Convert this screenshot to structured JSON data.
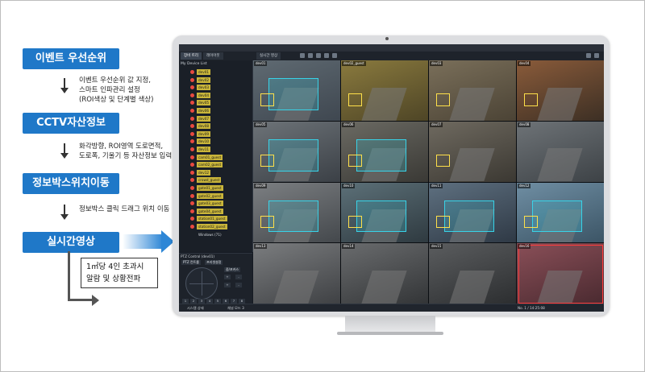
{
  "flow": {
    "steps": [
      {
        "label": "이벤트 우선순위",
        "note": "이벤트 우선순위 값 지정,\n스마트 인파관리 설정\n(ROI색상 및 단계별 색상)"
      },
      {
        "label": "CCTV자산정보",
        "note": "화각방향, ROI영역 도로면적,\n도로폭, 기울기 등 자산정보 입력"
      },
      {
        "label": "정보박스위치이동",
        "note": "정보박스 클릭 드래그 위치 이동"
      },
      {
        "label": "실시간영상"
      }
    ],
    "alert": "1㎡당 4인 초과시\n알람 및 상황전파"
  },
  "app": {
    "tabs": [
      "장비 트리",
      "레이아웃",
      "실시간 영상"
    ],
    "sidebar_title": "My Device List",
    "devices": [
      {
        "label": "dev01"
      },
      {
        "label": "dev02"
      },
      {
        "label": "dev03"
      },
      {
        "label": "dev04"
      },
      {
        "label": "dev05"
      },
      {
        "label": "dev06"
      },
      {
        "label": "dev07"
      },
      {
        "label": "dev08"
      },
      {
        "label": "dev09"
      },
      {
        "label": "dev10"
      },
      {
        "label": "dev11"
      },
      {
        "label": "cam01_guest"
      },
      {
        "label": "cam02_guest"
      },
      {
        "label": "dev12"
      },
      {
        "label": "crowd_guest"
      },
      {
        "label": "gate01_guest"
      },
      {
        "label": "gate02_guest"
      },
      {
        "label": "gate03_guest"
      },
      {
        "label": "gate04_guest"
      },
      {
        "label": "station01_guest"
      },
      {
        "label": "station02_guest"
      }
    ],
    "group_label": "Windows (71)",
    "ptz": {
      "title": "PTZ Control (dev01)",
      "tab1": "PTZ 컨트롤",
      "tab2": "프리셋설정",
      "zoom_label": "줌/포커스"
    },
    "status": {
      "left": "시스템 상태",
      "middle": "채널 모드 3",
      "right": "No. 1 / 14:25:08"
    },
    "cells": [
      {
        "label": "dev01"
      },
      {
        "label": "dev02_guest"
      },
      {
        "label": "dev03"
      },
      {
        "label": "dev04"
      },
      {
        "label": "dev05"
      },
      {
        "label": "dev06"
      },
      {
        "label": "dev07"
      },
      {
        "label": "dev08"
      },
      {
        "label": "dev09"
      },
      {
        "label": "dev10"
      },
      {
        "label": "dev11"
      },
      {
        "label": "dev12"
      },
      {
        "label": "dev13"
      },
      {
        "label": "dev14"
      },
      {
        "label": "dev15"
      },
      {
        "label": "dev16"
      }
    ]
  },
  "colors": {
    "step_blue": "#1f78c8",
    "roi": "#38d3e8",
    "device_tag": "#c9b53a",
    "alert_red": "#ff3b3b"
  }
}
